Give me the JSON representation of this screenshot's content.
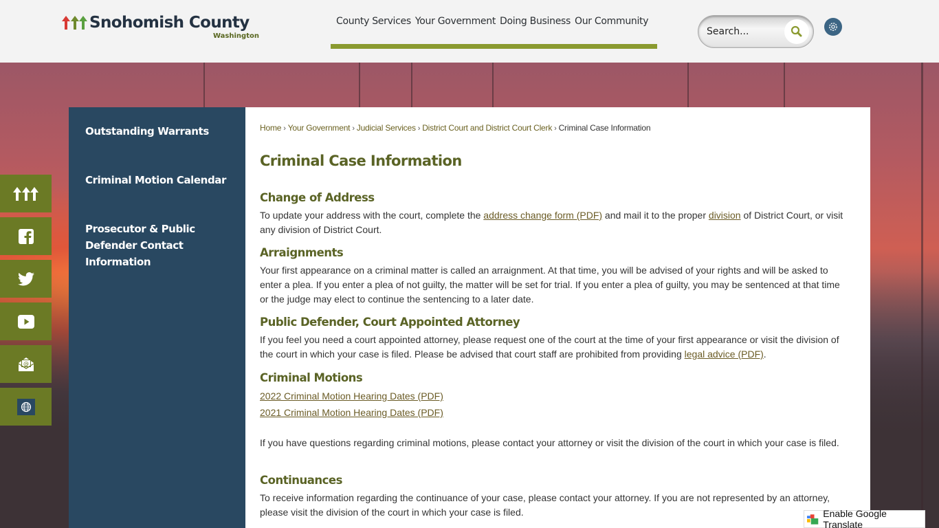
{
  "header": {
    "logo_name": "Snohomish County",
    "logo_state": "Washington",
    "nav": [
      "County Services",
      "Your Government",
      "Doing Business",
      "Our Community"
    ],
    "search_placeholder": "Search...",
    "search_icon": "magnifier-icon",
    "settings_icon": "gear-icon"
  },
  "colors": {
    "accent_green": "#8a9a2f",
    "heading_green": "#5a6325",
    "sidenav_blue": "#294861",
    "social_green": "#6b7a25"
  },
  "social": [
    {
      "name": "county-trees-icon"
    },
    {
      "name": "facebook-icon"
    },
    {
      "name": "twitter-icon"
    },
    {
      "name": "youtube-icon"
    },
    {
      "name": "email-icon"
    },
    {
      "name": "globe-icon"
    }
  ],
  "sidenav": {
    "items": [
      "Outstanding Warrants",
      "Criminal Motion Calendar",
      "Prosecutor & Public Defender Contact Information"
    ]
  },
  "breadcrumb": {
    "links": [
      "Home",
      "Your Government",
      "Judicial Services",
      "District Court and District Court Clerk"
    ],
    "current": "Criminal Case Information",
    "separator": "›"
  },
  "page": {
    "title": "Criminal Case Information",
    "sections": {
      "address": {
        "heading": "Change of Address",
        "t1": "To update your address with the court, complete the ",
        "link1": "address change form (PDF)",
        "t2": " and mail it to the proper ",
        "link2": "division",
        "t3": " of District Court, or visit any division of District Court."
      },
      "arraignments": {
        "heading": "Arraignments",
        "text": "Your first appearance on a criminal matter is called an arraignment. At that time, you will be advised of your rights and will be asked to enter a plea. If you enter a plea of not guilty, the matter will be set for trial. If you enter a plea of guilty, you may be sentenced at that time or the judge may elect to continue the sentencing to a later date."
      },
      "defender": {
        "heading": "Public Defender, Court Appointed Attorney",
        "t1": "If you feel you need a court appointed attorney, please request one of the court at the time of your first appearance or visit the division of the court in which your case is filed. Please be advised that court staff are prohibited from providing ",
        "link": "legal advice (PDF)",
        "t2": "."
      },
      "motions": {
        "heading": "Criminal Motions",
        "links": [
          "2022 Criminal Motion Hearing Dates (PDF)",
          "2021 Criminal Motion Hearing Dates (PDF)"
        ],
        "text": "If you have questions regarding criminal motions, please contact your attorney or visit the division of the court in which your case is filed."
      },
      "continuances": {
        "heading": "Continuances",
        "text": "To receive information regarding the continuance of your case, please contact your attorney. If you are not represented by an attorney, please visit the division of the court in which your case is filed."
      }
    }
  },
  "translate": {
    "label": "Enable Google Translate"
  }
}
